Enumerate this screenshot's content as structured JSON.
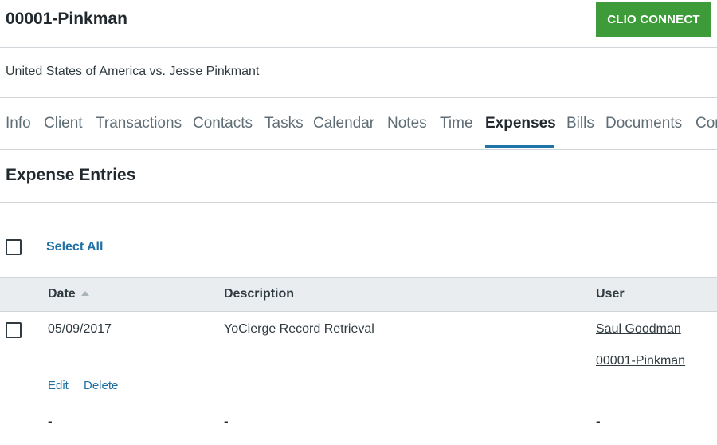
{
  "header": {
    "matter_title": "00001-Pinkman",
    "connect_label": "CLIO CONNECT"
  },
  "matter": {
    "description": "United States of America vs. Jesse Pinkmant"
  },
  "tabs": [
    {
      "label": "Info"
    },
    {
      "label": "Client"
    },
    {
      "label": "Transactions"
    },
    {
      "label": "Contacts"
    },
    {
      "label": "Tasks"
    },
    {
      "label": "Calendar"
    },
    {
      "label": "Notes"
    },
    {
      "label": "Time"
    },
    {
      "label": "Expenses",
      "active": true
    },
    {
      "label": "Bills"
    },
    {
      "label": "Documents"
    },
    {
      "label": "Com"
    }
  ],
  "section": {
    "title": "Expense Entries",
    "select_all_label": "Select All"
  },
  "table": {
    "columns": [
      "Date",
      "Description",
      "User"
    ],
    "sort_icon": "sort-ascending-icon",
    "rows": [
      {
        "date": "05/09/2017",
        "description": "YoCierge Record Retrieval",
        "user": "Saul Goodman",
        "matter": "00001-Pinkman",
        "edit_label": "Edit",
        "delete_label": "Delete"
      }
    ],
    "totals": {
      "date": "-",
      "description": "-",
      "user": "-"
    }
  },
  "colors": {
    "accent_green": "#3d9c39",
    "link_blue": "#1f6fa5",
    "tab_underline": "#1f75a8",
    "header_bg": "#e9edf0"
  }
}
